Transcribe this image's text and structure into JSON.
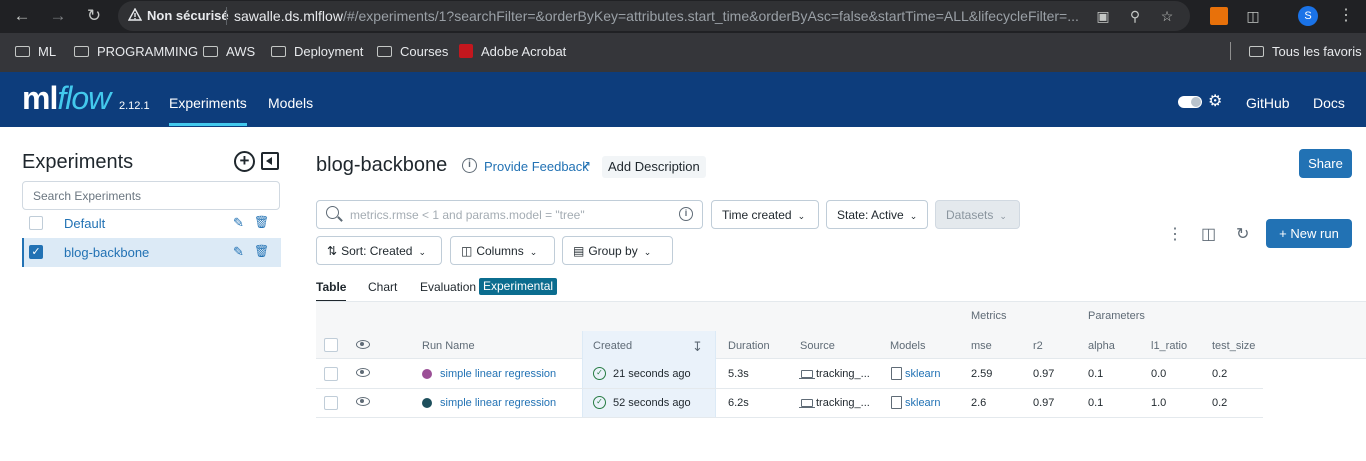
{
  "browser": {
    "security_label": "Non sécurisé",
    "url_host": "sawalle.ds.mlflow",
    "url_path": "/#/experiments/1?searchFilter=&orderByKey=attributes.start_time&orderByAsc=false&startTime=ALL&lifecycleFilter=...",
    "profile_initial": "S",
    "bookmarks": [
      "ML",
      "PROGRAMMING",
      "AWS",
      "Deployment",
      "Courses",
      "Adobe Acrobat"
    ],
    "all_bookmarks": "Tous les favoris"
  },
  "header": {
    "logo_ml": "ml",
    "logo_flow": "flow",
    "version": "2.12.1",
    "nav": [
      "Experiments",
      "Models"
    ],
    "github": "GitHub",
    "docs": "Docs"
  },
  "sidebar": {
    "title": "Experiments",
    "search_placeholder": "Search Experiments",
    "experiments": [
      {
        "name": "Default",
        "selected": false
      },
      {
        "name": "blog-backbone",
        "selected": true
      }
    ]
  },
  "main": {
    "title": "blog-backbone",
    "feedback": "Provide Feedback",
    "add_description": "Add Description",
    "share": "Share",
    "filter_placeholder": "metrics.rmse < 1 and params.model = \"tree\"",
    "time_created": "Time created",
    "state": "State: Active",
    "datasets": "Datasets",
    "sort": "Sort: Created",
    "columns": "Columns",
    "group_by": "Group by",
    "new_run": "New run",
    "tabs": [
      "Table",
      "Chart",
      "Evaluation"
    ],
    "experimental_badge": "Experimental"
  },
  "table": {
    "group_metrics": "Metrics",
    "group_parameters": "Parameters",
    "headers": [
      "Run Name",
      "Created",
      "Duration",
      "Source",
      "Models",
      "mse",
      "r2",
      "alpha",
      "l1_ratio",
      "test_size"
    ],
    "rows": [
      {
        "color": "#9b4f96",
        "run_name": "simple linear regression",
        "created": "21 seconds ago",
        "duration": "5.3s",
        "source": "tracking_...",
        "model": "sklearn",
        "mse": "2.59",
        "r2": "0.97",
        "alpha": "0.1",
        "l1_ratio": "0.0",
        "test_size": "0.2"
      },
      {
        "color": "#1d4f5c",
        "run_name": "simple linear regression",
        "created": "52 seconds ago",
        "duration": "6.2s",
        "source": "tracking_...",
        "model": "sklearn",
        "mse": "2.6",
        "r2": "0.97",
        "alpha": "0.1",
        "l1_ratio": "1.0",
        "test_size": "0.2"
      }
    ]
  }
}
